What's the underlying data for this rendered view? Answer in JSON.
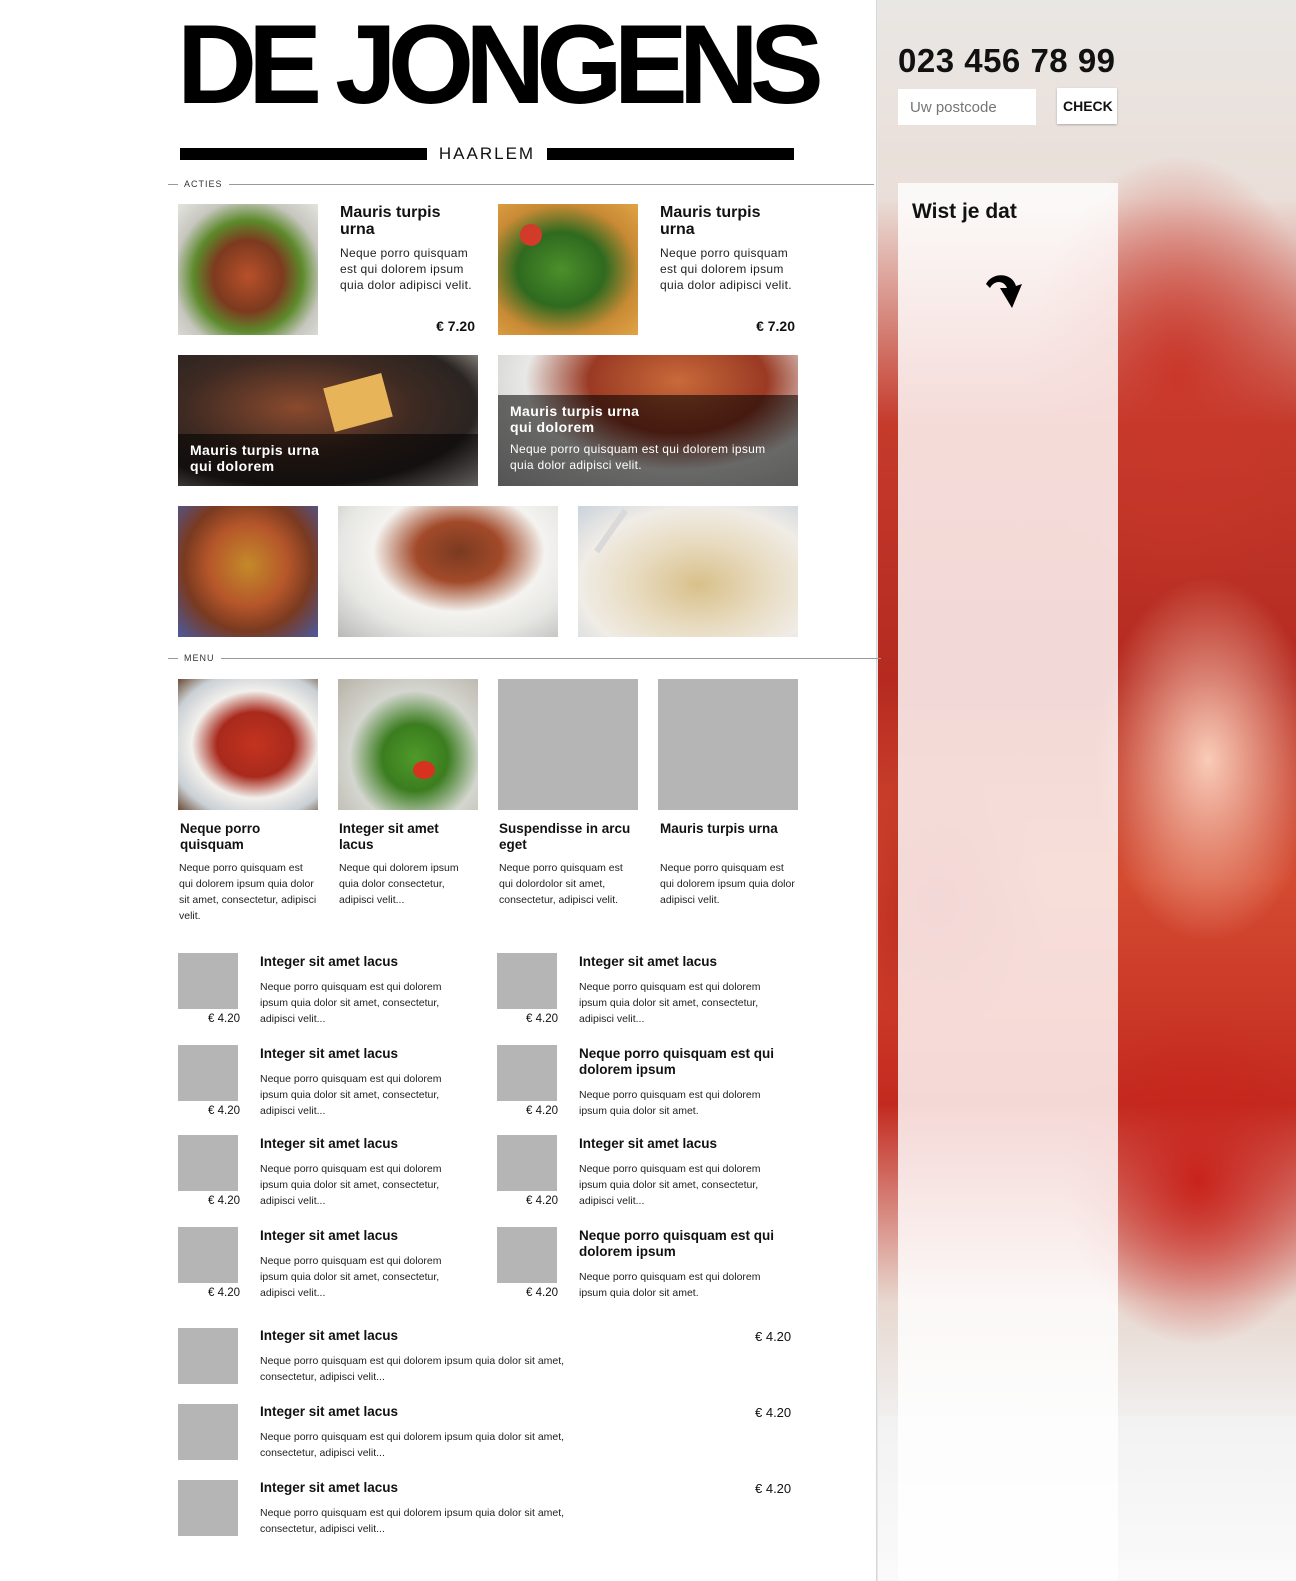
{
  "brand": {
    "name": "DE JONGENS",
    "city": "HAARLEM"
  },
  "sections": {
    "acties": "ACTIES",
    "menu": "MENU"
  },
  "promos": [
    {
      "title": "Mauris turpis urna",
      "desc": "Neque porro quisquam est qui dolorem ipsum quia dolor adipisci velit.",
      "price": "€ 7.20"
    },
    {
      "title": "Mauris turpis urna",
      "desc": "Neque porro quisquam est qui dolorem ipsum quia dolor adipisci velit.",
      "price": "€ 7.20"
    }
  ],
  "banners": [
    {
      "title": "Mauris turpis urna qui dolorem"
    },
    {
      "title": "Mauris turpis urna qui dolorem",
      "desc": "Neque porro quisquam est qui dolorem ipsum quia dolor adipisci velit."
    }
  ],
  "menu_cards": [
    {
      "title": "Neque porro quisquam",
      "desc": "Neque porro quisquam est qui dolorem ipsum quia dolor sit amet, consectetur, adipisci velit."
    },
    {
      "title": "Integer sit amet lacus",
      "desc": "Neque  qui dolorem ipsum quia dolor consectetur, adipisci velit..."
    },
    {
      "title": "Suspendisse in arcu eget",
      "desc": "Neque porro quisquam est qui dolordolor sit amet, consectetur, adipisci velit."
    },
    {
      "title": "Mauris turpis urna",
      "desc": "Neque porro quisquam est qui dolorem ipsum quia dolor adipisci velit."
    }
  ],
  "list_left": [
    {
      "title": "Integer sit amet lacus",
      "desc": "Neque porro quisquam est qui dolorem ipsum quia dolor sit amet, consectetur, adipisci velit...",
      "price": "€ 4.20"
    },
    {
      "title": "Integer sit amet lacus",
      "desc": "Neque porro quisquam est qui dolorem ipsum quia dolor sit amet, consectetur, adipisci velit...",
      "price": "€ 4.20"
    },
    {
      "title": "Integer sit amet lacus",
      "desc": "Neque porro quisquam est qui dolorem ipsum quia dolor sit amet, consectetur, adipisci velit...",
      "price": "€ 4.20"
    },
    {
      "title": "Integer sit amet lacus",
      "desc": "Neque porro quisquam est qui dolorem ipsum quia dolor sit amet, consectetur, adipisci velit...",
      "price": "€ 4.20"
    }
  ],
  "list_right": [
    {
      "title": "Integer sit amet lacus",
      "desc": "Neque porro quisquam est qui dolorem ipsum quia dolor sit amet, consectetur, adipisci velit...",
      "price": "€ 4.20"
    },
    {
      "title": "Neque porro quisquam est qui dolorem ipsum",
      "desc": "Neque porro quisquam est qui dolorem ipsum quia dolor sit amet.",
      "price": "€ 4.20"
    },
    {
      "title": "Integer sit amet lacus",
      "desc": "Neque porro quisquam est qui dolorem ipsum quia dolor sit amet, consectetur, adipisci velit...",
      "price": "€ 4.20"
    },
    {
      "title": "Neque porro quisquam est qui dolorem ipsum",
      "desc": "Neque porro quisquam est qui dolorem ipsum quia dolor sit amet.",
      "price": "€ 4.20"
    }
  ],
  "list_wide": [
    {
      "title": "Integer sit amet lacus",
      "desc": "Neque porro quisquam est qui dolorem ipsum quia dolor sit amet, consectetur, adipisci velit...",
      "price": "€ 4.20"
    },
    {
      "title": "Integer sit amet lacus",
      "desc": "Neque porro quisquam est qui dolorem ipsum quia dolor sit amet, consectetur, adipisci velit...",
      "price": "€ 4.20"
    },
    {
      "title": "Integer sit amet lacus",
      "desc": "Neque porro quisquam est qui dolorem ipsum quia dolor sit amet, consectetur, adipisci velit...",
      "price": "€ 4.20"
    }
  ],
  "sidebar": {
    "phone": "023 456 78 99",
    "postcode_placeholder": "Uw postcode",
    "check_label": "CHECK",
    "wist_title": "Wist je dat",
    "arrow_icon": "curved-arrow-down-icon"
  },
  "colors": {
    "placeholder_gray": "#b5b5b5",
    "accent_red": "#c43a2b"
  }
}
